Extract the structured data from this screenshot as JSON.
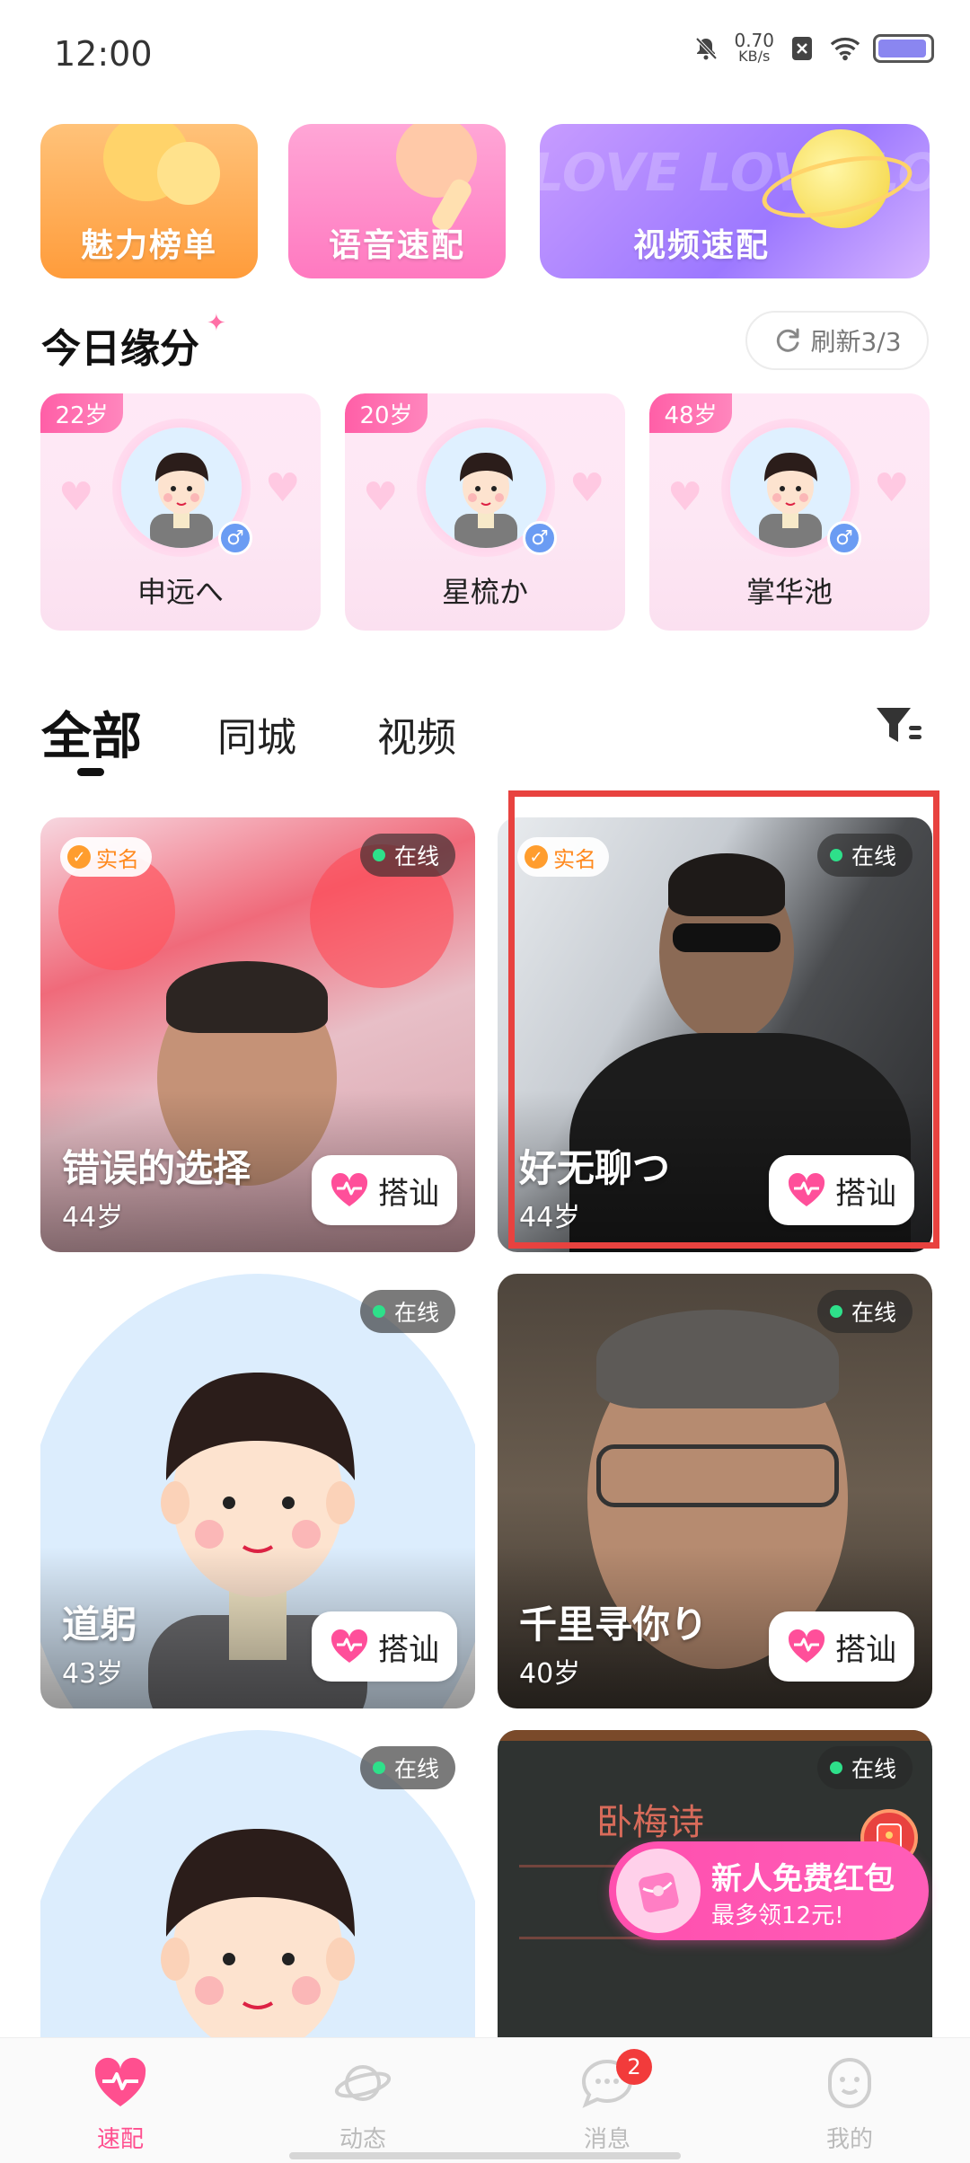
{
  "status_bar": {
    "time": "12:00",
    "net_speed_value": "0.70",
    "net_speed_unit": "KB/s"
  },
  "features": [
    {
      "label": "魅力榜单"
    },
    {
      "label": "语音速配"
    },
    {
      "label": "视频速配",
      "bg_text": "LOVE LOVE LOVE"
    }
  ],
  "today": {
    "title": "今日缘分",
    "refresh_label": "刷新3/3",
    "cards": [
      {
        "age": "22岁",
        "name": "申远へ"
      },
      {
        "age": "20岁",
        "name": "星梳か"
      },
      {
        "age": "48岁",
        "name": "掌华池"
      }
    ]
  },
  "tabs": [
    {
      "label": "全部",
      "active": true
    },
    {
      "label": "同城",
      "active": false
    },
    {
      "label": "视频",
      "active": false
    }
  ],
  "users": [
    {
      "name": "错误的选择",
      "age": "44岁",
      "verified": "实名",
      "online": "在线",
      "greet": "搭讪"
    },
    {
      "name": "好无聊つ",
      "age": "44岁",
      "verified": "实名",
      "online": "在线",
      "greet": "搭讪"
    },
    {
      "name": "道躬",
      "age": "43岁",
      "online": "在线",
      "greet": "搭讪"
    },
    {
      "name": "千里寻你り",
      "age": "40岁",
      "online": "在线",
      "greet": "搭讪"
    },
    {
      "online": "在线"
    },
    {
      "online": "在线",
      "board_text": "卧梅诗"
    }
  ],
  "promo": {
    "title": "新人免费红包",
    "subtitle": "最多领12元!"
  },
  "bottom_nav": [
    {
      "label": "速配",
      "icon": "heartbeat-icon",
      "active": true
    },
    {
      "label": "动态",
      "icon": "planet-icon",
      "active": false
    },
    {
      "label": "消息",
      "icon": "chat-bubble-icon",
      "active": false,
      "badge": "2"
    },
    {
      "label": "我的",
      "icon": "profile-icon",
      "active": false
    }
  ],
  "colors": {
    "accent_pink": "#ff4f8f",
    "online_green": "#2ee08a",
    "verified_orange": "#ff9d2e",
    "highlight_red": "#e8423f"
  }
}
